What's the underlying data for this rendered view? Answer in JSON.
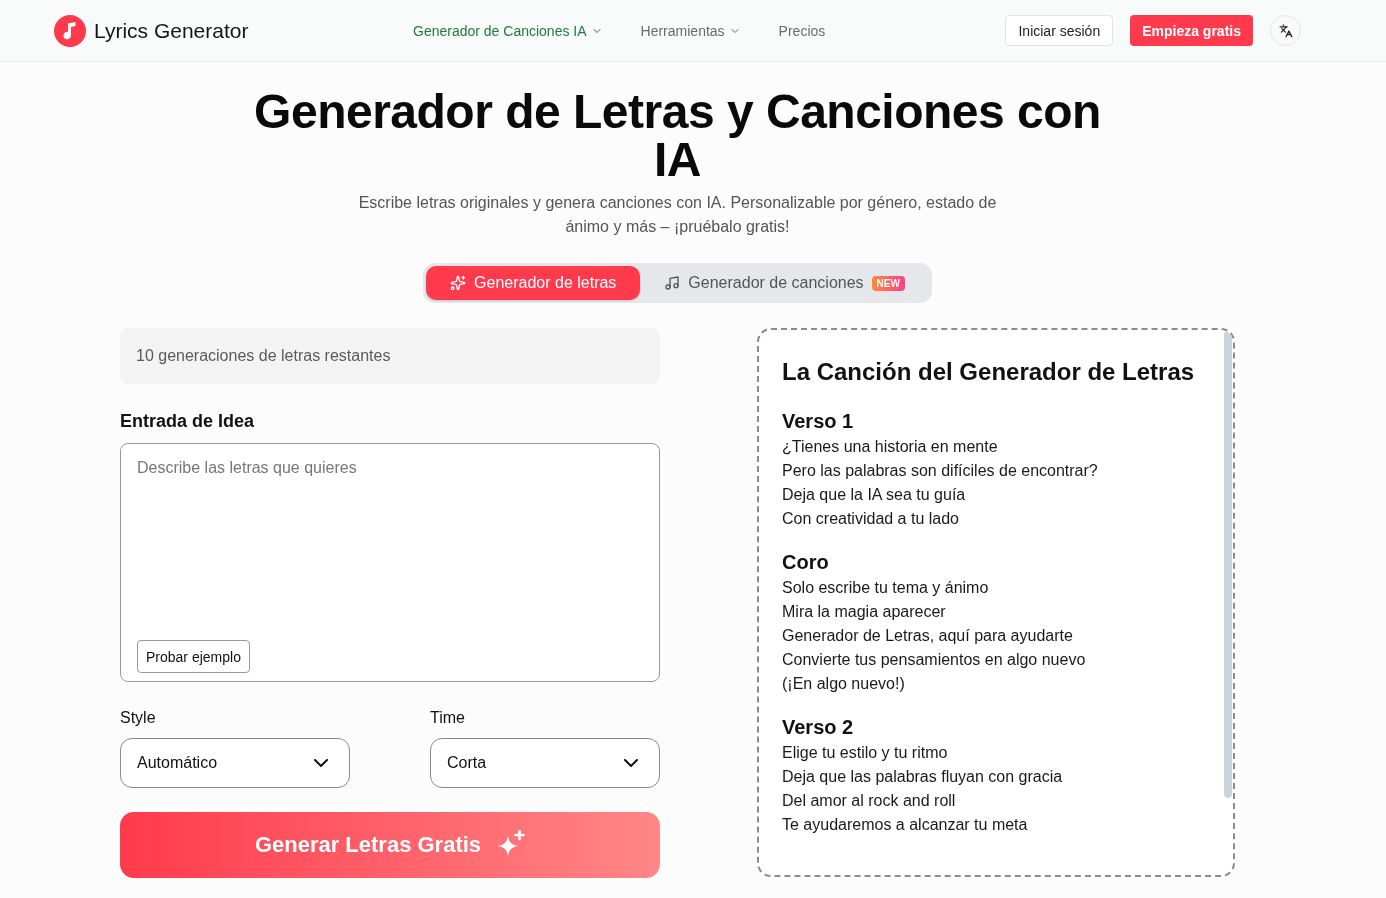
{
  "header": {
    "logo_text": "Lyrics Generator",
    "nav": [
      {
        "label": "Generador de Canciones IA",
        "has_menu": true,
        "selected": true
      },
      {
        "label": "Herramientas",
        "has_menu": true,
        "selected": false
      },
      {
        "label": "Precios",
        "has_menu": false,
        "selected": false
      }
    ],
    "login_button": "Iniciar sesión",
    "signup_button": "Empieza gratis"
  },
  "hero": {
    "title": "Generador de Letras y Canciones con IA",
    "subtitle": "Escribe letras originales y genera canciones con IA. Personalizable por género, estado de ánimo y más – ¡pruébalo gratis!"
  },
  "mode_tabs": [
    {
      "label": "Generador de letras",
      "kind": "lyrics",
      "selected": true
    },
    {
      "label": "Generador de canciones",
      "kind": "song",
      "selected": false,
      "badge": "NEW"
    }
  ],
  "form": {
    "remaining_notice": "10 generaciones de letras restantes",
    "idea_label": "Entrada de Idea",
    "idea_input": {
      "placeholder": "Describe las letras que quieres"
    },
    "example_button": "Probar ejemplo",
    "selects": [
      {
        "label": "Style",
        "value": "Automático"
      },
      {
        "label": "Time",
        "value": "Corta"
      }
    ],
    "submit_button": "Generar Letras Gratis"
  },
  "lyrics_panel": {
    "title": "La Canción del Generador de Letras",
    "sections": [
      {
        "heading": "Verso 1",
        "lines": [
          "¿Tienes una historia en mente",
          "Pero las palabras son difíciles de encontrar?",
          "Deja que la IA sea tu guía",
          "Con creatividad a tu lado"
        ]
      },
      {
        "heading": "Coro",
        "lines": [
          "Solo escribe tu tema y ánimo",
          "Mira la magia aparecer",
          "Generador de Letras, aquí para ayudarte",
          "Convierte tus pensamientos en algo nuevo",
          "(¡En algo nuevo!)"
        ]
      },
      {
        "heading": "Verso 2",
        "lines": [
          "Elige tu estilo y tu ritmo",
          "Deja que las palabras fluyan con gracia",
          "Del amor al rock and roll",
          "Te ayudaremos a alcanzar tu meta"
        ]
      }
    ]
  }
}
